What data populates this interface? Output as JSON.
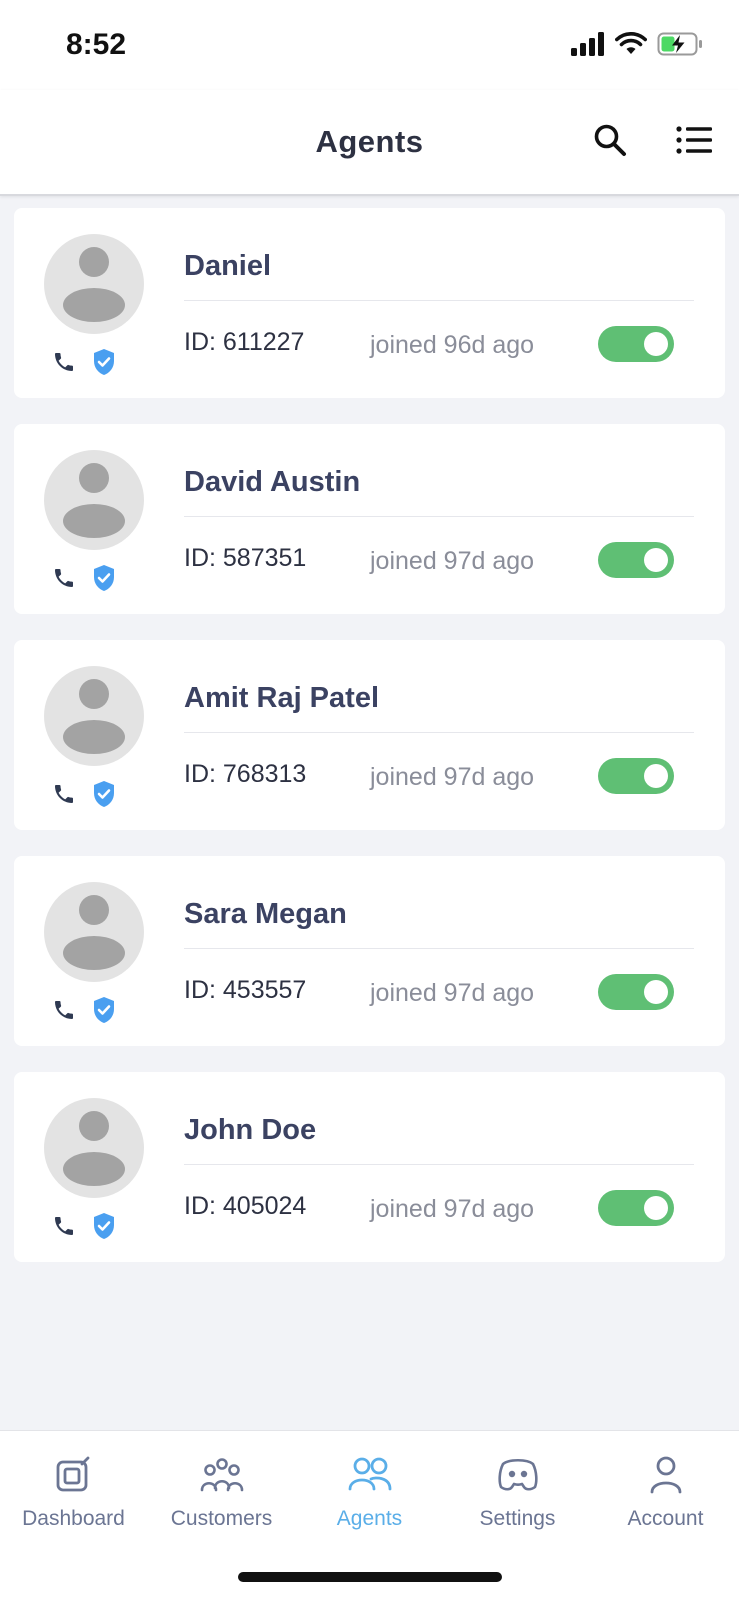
{
  "status_bar": {
    "time": "8:52"
  },
  "header": {
    "title": "Agents"
  },
  "agents": [
    {
      "name": "Daniel",
      "id": "ID: 611227",
      "joined": "joined 96d ago",
      "active": true
    },
    {
      "name": "David Austin",
      "id": "ID: 587351",
      "joined": "joined 97d ago",
      "active": true
    },
    {
      "name": "Amit Raj Patel",
      "id": "ID: 768313",
      "joined": "joined 97d ago",
      "active": true
    },
    {
      "name": "Sara Megan",
      "id": "ID: 453557",
      "joined": "joined 97d ago",
      "active": true
    },
    {
      "name": "John Doe",
      "id": "ID: 405024",
      "joined": "joined 97d ago",
      "active": true
    }
  ],
  "tabs": [
    {
      "label": "Dashboard",
      "icon": "dashboard-icon",
      "active": false
    },
    {
      "label": "Customers",
      "icon": "customers-icon",
      "active": false
    },
    {
      "label": "Agents",
      "icon": "agents-icon",
      "active": true
    },
    {
      "label": "Settings",
      "icon": "settings-icon",
      "active": false
    },
    {
      "label": "Account",
      "icon": "account-icon",
      "active": false
    }
  ],
  "colors": {
    "accent": "#5aaee8",
    "toggle_on": "#5fbf74",
    "verified": "#4a9ff0",
    "name_text": "#3b4262",
    "tab_inactive": "#6b7593"
  }
}
